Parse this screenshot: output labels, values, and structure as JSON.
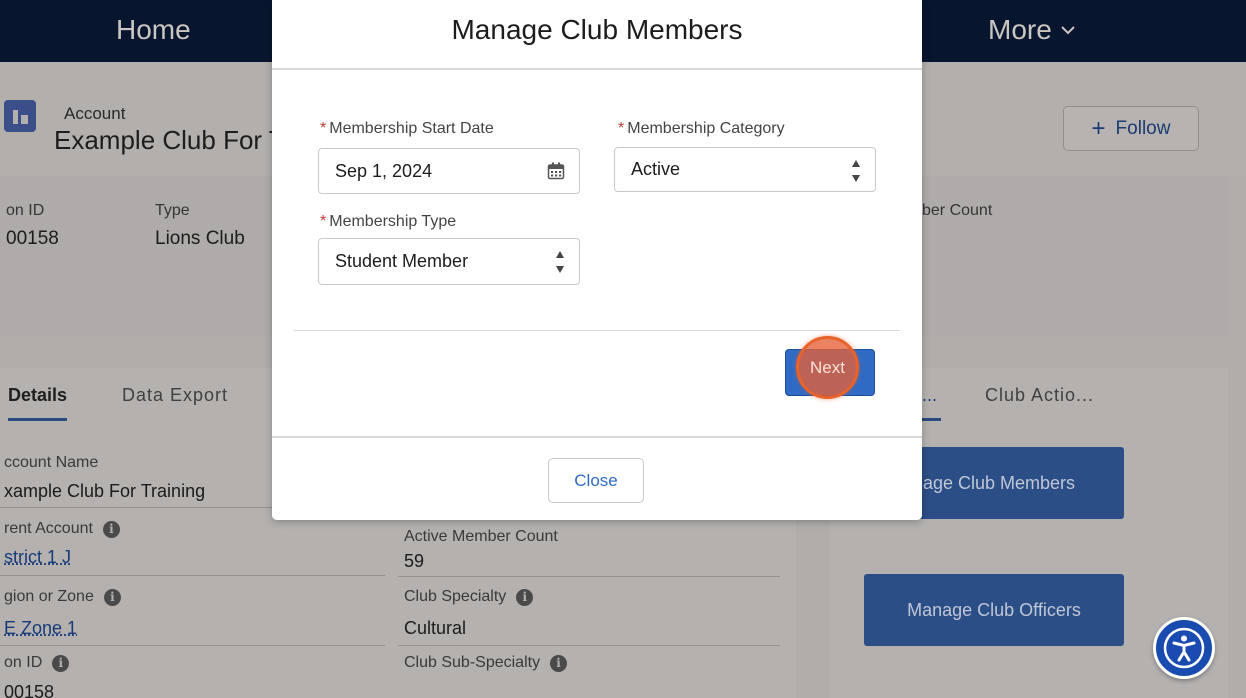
{
  "nav": {
    "home": "Home",
    "more": "More"
  },
  "record": {
    "object_label": "Account",
    "title": "Example Club For T",
    "follow_label": "Follow"
  },
  "highlights": [
    {
      "label": "on ID",
      "value": "00158"
    },
    {
      "label": "Type",
      "value": "Lions Club"
    },
    {
      "label": "ber Count",
      "value": ""
    }
  ],
  "tabs": [
    {
      "label": "Details",
      "active": true
    },
    {
      "label": "Data Export",
      "active": false
    }
  ],
  "fields": {
    "account_name": {
      "label": "ccount Name",
      "value": "xample Club For Training"
    },
    "parent_account": {
      "label": "rent Account",
      "value": "strict 1 J"
    },
    "region_zone": {
      "label": "gion or Zone",
      "value": "E Zone 1"
    },
    "on_id": {
      "label": "on ID",
      "value": "00158"
    },
    "active_member_count": {
      "label": "Active Member Count",
      "value": "59"
    },
    "club_specialty": {
      "label": "Club Specialty",
      "value": "Cultural"
    },
    "club_sub_specialty": {
      "label": "Club Sub-Specialty",
      "value": ""
    }
  },
  "side": {
    "tabs": [
      {
        "label": "...",
        "active": true
      },
      {
        "label": "Club Actio...",
        "active": false
      }
    ],
    "buttons": {
      "manage_members": "nage Club Members",
      "manage_officers": "Manage Club Officers"
    }
  },
  "modal": {
    "title": "Manage Club Members",
    "required_mark": "*",
    "start_date": {
      "label": "Membership Start Date",
      "value": "Sep 1, 2024"
    },
    "category": {
      "label": "Membership Category",
      "value": "Active"
    },
    "type": {
      "label": "Membership Type",
      "value": "Student Member"
    },
    "next_label": "Next",
    "close_label": "Close"
  },
  "colors": {
    "nav_bg": "#08152e",
    "brand_button": "#2f6bc5",
    "required": "#c23934",
    "click_marker": "#e8632a",
    "accessibility": "#1a4bb0"
  },
  "icons": [
    "calendar-icon",
    "select-arrows-icon",
    "info-icon",
    "chevron-down-icon",
    "plus-icon",
    "accessibility-icon",
    "account-record-icon"
  ]
}
